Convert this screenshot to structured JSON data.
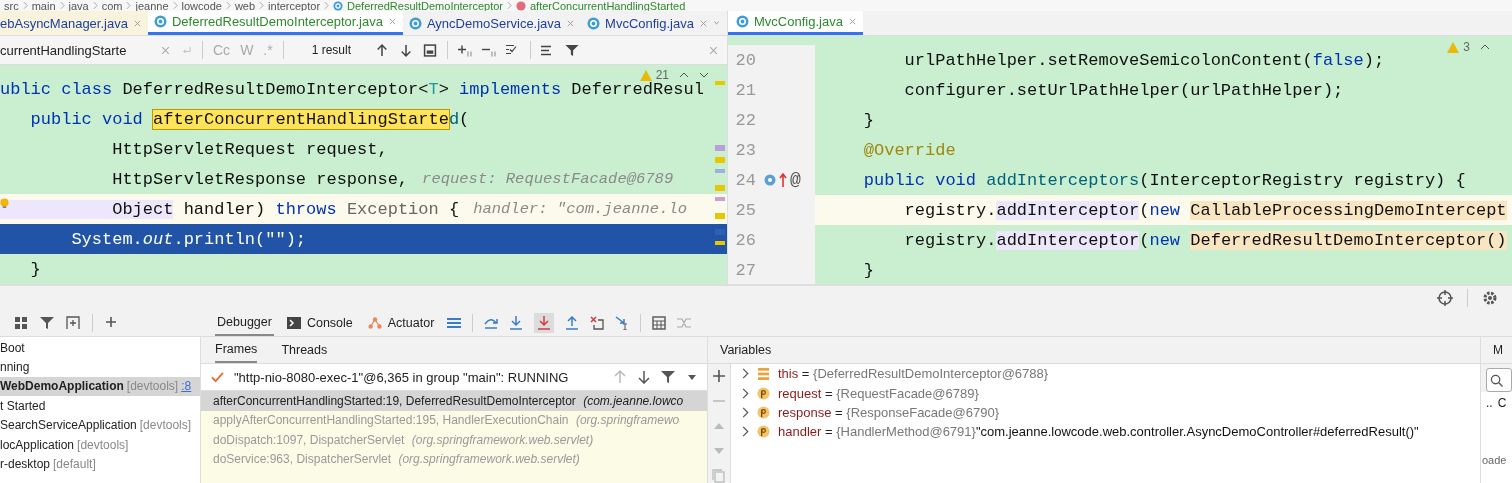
{
  "breadcrumb": [
    {
      "label": "src",
      "kind": "folder"
    },
    {
      "label": "main",
      "kind": "folder"
    },
    {
      "label": "java",
      "kind": "folder"
    },
    {
      "label": "com",
      "kind": "folder"
    },
    {
      "label": "jeanne",
      "kind": "folder"
    },
    {
      "label": "lowcode",
      "kind": "folder"
    },
    {
      "label": "web",
      "kind": "folder"
    },
    {
      "label": "interceptor",
      "kind": "folder"
    },
    {
      "label": "DeferredResultDemoInterceptor",
      "kind": "class"
    },
    {
      "label": "afterConcurrentHandlingStarted",
      "kind": "method"
    }
  ],
  "left_editor": {
    "tabs": [
      {
        "label": "ebAsyncManager.java",
        "selected": false,
        "modified": true
      },
      {
        "label": "DeferredResultDemoInterceptor.java",
        "selected": true,
        "modified": false
      },
      {
        "label": "AyncDemoService.java",
        "selected": false,
        "modified": false
      },
      {
        "label": "MvcConfig.java",
        "selected": false,
        "modified": false
      }
    ],
    "find": {
      "value": "currentHandlingStarte",
      "options": [
        "Cc",
        "W",
        ".*"
      ],
      "result": "1 result"
    },
    "warnings": "21",
    "lines": [
      {
        "current": false,
        "execution": false,
        "bulb": false,
        "tokens": [
          {
            "t": "ublic class ",
            "kind": "kw"
          },
          {
            "t": "DeferredResultDemoInterceptor<",
            "kind": "plain"
          },
          {
            "t": "T",
            "kind": "tparam"
          },
          {
            "t": "> ",
            "kind": "plain"
          },
          {
            "t": "implements ",
            "kind": "kw"
          },
          {
            "t": "DeferredResul",
            "kind": "plain"
          }
        ]
      },
      {
        "current": false,
        "execution": false,
        "bulb": false,
        "tokens": [
          {
            "t": "   public void ",
            "kind": "kw"
          },
          {
            "t": "afterConcurrentHandlingStarte",
            "kind": "hl"
          },
          {
            "t": "d",
            "kind": "method"
          },
          {
            "t": "(",
            "kind": "plain"
          }
        ]
      },
      {
        "current": false,
        "execution": false,
        "bulb": false,
        "tokens": [
          {
            "t": "           HttpServletRequest request,",
            "kind": "plain"
          }
        ]
      },
      {
        "current": false,
        "execution": false,
        "bulb": false,
        "tokens": [
          {
            "t": "           HttpServletResponse response,",
            "kind": "plain"
          }
        ],
        "hint": "request: RequestFacade@6789"
      },
      {
        "current": true,
        "execution": false,
        "bulb": true,
        "tokens": [
          {
            "t": "           Object",
            "kind": "ref"
          },
          {
            "t": " handler) ",
            "kind": "plain"
          },
          {
            "t": "throws ",
            "kind": "kw"
          },
          {
            "t": "Exception",
            "kind": "gray"
          },
          {
            "t": " {",
            "kind": "plain"
          }
        ],
        "hint": "handler: \"com.jeanne.lo"
      },
      {
        "current": false,
        "execution": true,
        "bulb": false,
        "tokens": [
          {
            "t": "       System.",
            "kind": "plain"
          },
          {
            "t": "out",
            "kind": "field"
          },
          {
            "t": ".println(\"\");",
            "kind": "plain"
          }
        ]
      },
      {
        "current": false,
        "execution": false,
        "bulb": false,
        "tokens": [
          {
            "t": "   }",
            "kind": "plain"
          }
        ]
      }
    ]
  },
  "right_editor": {
    "tabs": [
      {
        "label": "MvcConfig.java",
        "selected": true,
        "modified": false
      }
    ],
    "warnings": "3",
    "lines": [
      {
        "number": "20",
        "current": false,
        "tokens": [
          {
            "t": "        urlPathHelper.setRemoveSemicolonContent(",
            "kind": "plain"
          },
          {
            "t": "false",
            "kind": "kw"
          },
          {
            "t": ");",
            "kind": "plain"
          }
        ]
      },
      {
        "number": "21",
        "current": false,
        "tokens": [
          {
            "t": "        configurer.setUrlPathHelper(urlPathHelper);",
            "kind": "plain"
          }
        ]
      },
      {
        "number": "22",
        "current": false,
        "tokens": [
          {
            "t": "    }",
            "kind": "plain"
          }
        ]
      },
      {
        "number": "23",
        "current": false,
        "tokens": [
          {
            "t": "    @Override",
            "kind": "anno"
          }
        ]
      },
      {
        "number": "24",
        "current": false,
        "gutter_mark": "@",
        "tokens": [
          {
            "t": "    public void ",
            "kind": "kw"
          },
          {
            "t": "addInterceptors",
            "kind": "method"
          },
          {
            "t": "(InterceptorRegistry registry) {",
            "kind": "plain"
          }
        ]
      },
      {
        "number": "25",
        "current": true,
        "tokens": [
          {
            "t": "        registry.",
            "kind": "plain"
          },
          {
            "t": "addInterceptor",
            "kind": "ref"
          },
          {
            "t": "(",
            "kind": "plain"
          },
          {
            "t": "new ",
            "kind": "kw"
          },
          {
            "t": "CallableProcessingDemoIntercept",
            "kind": "cls"
          }
        ]
      },
      {
        "number": "26",
        "current": false,
        "tokens": [
          {
            "t": "        registry.",
            "kind": "plain"
          },
          {
            "t": "addInterceptor",
            "kind": "ref"
          },
          {
            "t": "(",
            "kind": "plain"
          },
          {
            "t": "new ",
            "kind": "kw"
          },
          {
            "t": "DeferredResultDemoInterceptor()",
            "kind": "cls"
          }
        ]
      },
      {
        "number": "27",
        "current": false,
        "tokens": [
          {
            "t": "    }",
            "kind": "plain"
          }
        ]
      }
    ]
  },
  "services": [
    {
      "selected": false,
      "parts": [
        {
          "t": "Boot",
          "kind": "name"
        }
      ]
    },
    {
      "selected": false,
      "parts": [
        {
          "t": "nning",
          "kind": "name"
        }
      ]
    },
    {
      "selected": true,
      "parts": [
        {
          "t": "WebDemoApplication",
          "kind": "bold"
        },
        {
          "t": "[devtools]",
          "kind": "tag"
        },
        {
          "t": ":8",
          "kind": "link"
        }
      ]
    },
    {
      "selected": false,
      "parts": [
        {
          "t": "t Started",
          "kind": "name"
        }
      ]
    },
    {
      "selected": false,
      "parts": [
        {
          "t": "SearchServiceApplication",
          "kind": "name"
        },
        {
          "t": "[devtools]",
          "kind": "tag"
        }
      ]
    },
    {
      "selected": false,
      "parts": [
        {
          "t": "locApplication",
          "kind": "name"
        },
        {
          "t": "[devtools]",
          "kind": "tag"
        }
      ]
    },
    {
      "selected": false,
      "parts": [
        {
          "t": "r-desktop",
          "kind": "name"
        },
        {
          "t": "[default]",
          "kind": "tag"
        }
      ]
    }
  ],
  "debugger": {
    "tabs": [
      {
        "label": "Debugger",
        "selected": true,
        "kind": "plain"
      },
      {
        "label": "Console",
        "selected": false,
        "kind": "console"
      },
      {
        "label": "Actuator",
        "selected": false,
        "kind": "actuator"
      }
    ],
    "subtabs": [
      {
        "label": "Frames",
        "selected": true
      },
      {
        "label": "Threads",
        "selected": false
      }
    ],
    "thread": "\"http-nio-8080-exec-1\"@6,365 in group \"main\": RUNNING",
    "frames": [
      {
        "method": "afterConcurrentHandlingStarted:19, DeferredResultDemoInterceptor",
        "package": "(com.jeanne.lowco",
        "selected": true,
        "library": false
      },
      {
        "method": "applyAfterConcurrentHandlingStarted:195, HandlerExecutionChain",
        "package": "(org.springframewo",
        "selected": false,
        "library": true
      },
      {
        "method": "doDispatch:1097, DispatcherServlet",
        "package": "(org.springframework.web.servlet)",
        "selected": false,
        "library": true
      },
      {
        "method": "doService:963, DispatcherServlet",
        "package": "(org.springframework.web.servlet)",
        "selected": false,
        "library": true
      }
    ],
    "variables_title": "Variables",
    "variables": [
      {
        "kind": "field",
        "name": "this",
        "sign": "=",
        "value": "{DeferredResultDemoInterceptor@6788}"
      },
      {
        "kind": "param",
        "name": "request",
        "sign": "=",
        "value": "{RequestFacade@6789}"
      },
      {
        "kind": "param",
        "name": "response",
        "sign": "=",
        "value": "{ResponseFacade@6790}"
      },
      {
        "kind": "param",
        "name": "handler",
        "sign": "=",
        "value": "{HandlerMethod@6791}",
        "extra": "\"com.jeanne.lowcode.web.controller.AsyncDemoController#deferredResult()\""
      }
    ]
  },
  "side_pane": {
    "tab": "M",
    "row": [
      "..",
      "C"
    ],
    "text": "oade"
  }
}
